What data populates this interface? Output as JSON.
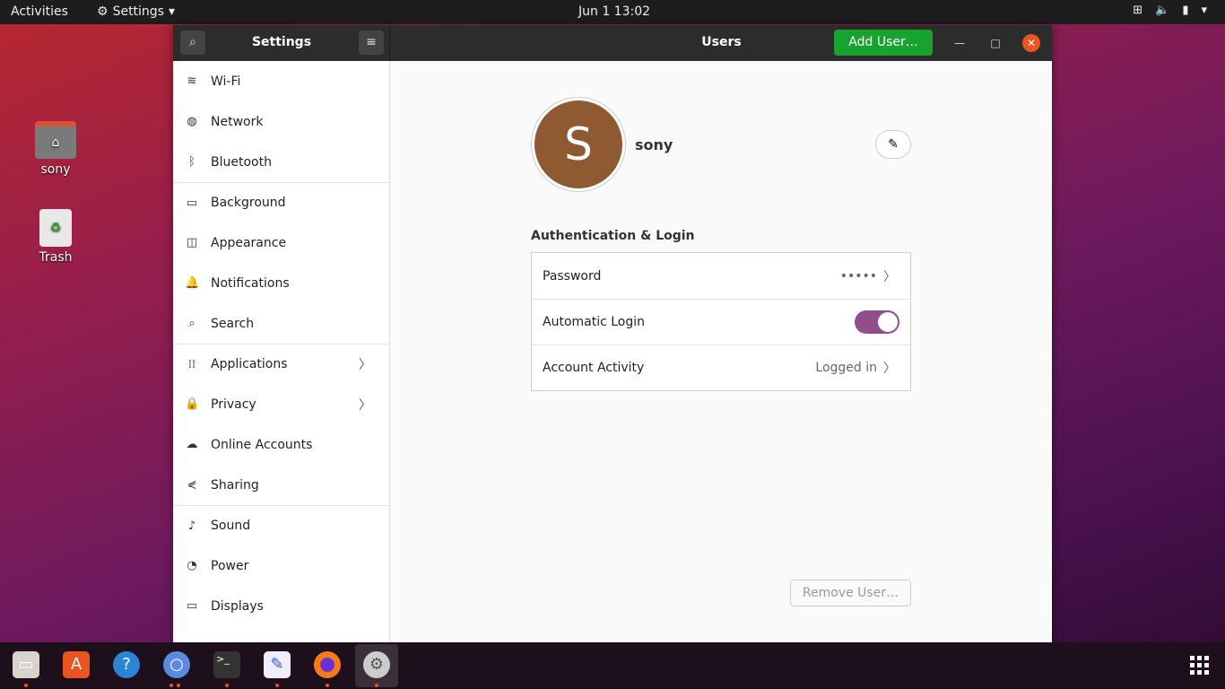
{
  "topbar": {
    "activities": "Activities",
    "app": "Settings",
    "clock": "Jun 1  13:02"
  },
  "desktop": [
    {
      "label": "sony",
      "icon": "home-folder-icon"
    },
    {
      "label": "Trash",
      "icon": "trash-icon"
    }
  ],
  "window": {
    "sidebar_title": "Settings",
    "page_title": "Users",
    "add_user": "Add User…"
  },
  "sidebar": {
    "items": [
      {
        "label": "Wi-Fi",
        "icon": "wifi-icon"
      },
      {
        "label": "Network",
        "icon": "network-icon"
      },
      {
        "label": "Bluetooth",
        "icon": "bluetooth-icon"
      },
      {
        "label": "Background",
        "icon": "background-icon"
      },
      {
        "label": "Appearance",
        "icon": "appearance-icon"
      },
      {
        "label": "Notifications",
        "icon": "bell-icon"
      },
      {
        "label": "Search",
        "icon": "search-icon"
      },
      {
        "label": "Applications",
        "icon": "apps-icon"
      },
      {
        "label": "Privacy",
        "icon": "lock-icon"
      },
      {
        "label": "Online Accounts",
        "icon": "cloud-icon"
      },
      {
        "label": "Sharing",
        "icon": "share-icon"
      },
      {
        "label": "Sound",
        "icon": "music-icon"
      },
      {
        "label": "Power",
        "icon": "power-icon"
      },
      {
        "label": "Displays",
        "icon": "display-icon"
      }
    ]
  },
  "user": {
    "initial": "S",
    "name": "sony",
    "avatar_color": "#8f5a31"
  },
  "auth": {
    "heading": "Authentication & Login",
    "password_label": "Password",
    "password_value": "•••••",
    "autologin_label": "Automatic Login",
    "autologin_on": true,
    "activity_label": "Account Activity",
    "activity_value": "Logged in"
  },
  "remove_user": "Remove User…",
  "colors": {
    "accent": "#17a32e",
    "toggle": "#924d8b",
    "close": "#e95420"
  }
}
